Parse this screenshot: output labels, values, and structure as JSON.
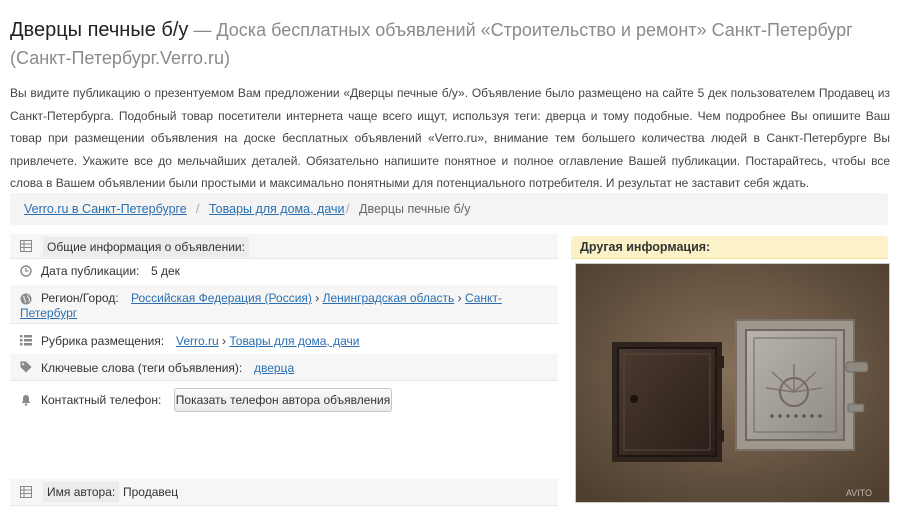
{
  "header": {
    "title": "Дверцы печные б/у",
    "subtitle": " — Доска бесплатных объявлений «Строительство и ремонт» Санкт-Петербург (Санкт-Петербург.Verro.ru)"
  },
  "intro": "Вы видите публикацию о презентуемом Вам предложении «Дверцы печные б/у». Объявление было размещено на сайте 5 дек пользователем Продавец из Санкт-Петербурга. Подобный товар посетители интернета чаще всего ищут, используя теги: дверца и тому подобные. Чем подробнее Вы опишите Ваш товар при размещении объявления на доске бесплатных объявлений «Verro.ru», внимание тем большего количества людей в Санкт-Петербурге Вы привлечете. Укажите все до мельчайших деталей. Обязательно напишите понятное и полное оглавление Вашей публикации. Постарайтесь, чтобы все слова в Вашем объявлении были простыми и максимально понятными для потенциального потребителя. И результат не заставит себя ждать.",
  "breadcrumb": {
    "items": [
      "Verro.ru в Санкт-Петербурге",
      "Товары для дома, дачи"
    ],
    "separator": "/",
    "current": "Дверцы печные б/у"
  },
  "info": {
    "header": "Общие информация о объявлении:",
    "date_label": "Дата публикации:",
    "date_value": "5 дек",
    "region_label": "Регион/Город:",
    "region_country": "Российская Федерация (Россия)",
    "region_oblast": "Ленинградская область",
    "region_city_1": "Санкт-",
    "region_city_2": "Петербург",
    "arrow": "›",
    "rubric_label": "Рубрика размещения:",
    "rubric_site": "Verro.ru",
    "rubric_cat": "Товары для дома, дачи",
    "keywords_label": "Ключевые слова (теги объявления):",
    "keyword": "дверца",
    "phone_label": "Контактный телефон:",
    "phone_button": "Показать телефон автора объявления",
    "author_label": "Имя автора:",
    "author_value": "Продавец"
  },
  "other": {
    "header": "Другая информация:",
    "watermark": "AVITO"
  },
  "icons": {
    "info": "table-icon",
    "date": "clock-icon",
    "region": "globe-icon",
    "rubric": "list-icon",
    "keywords": "tag-icon",
    "phone": "bell-icon",
    "author": "table-icon"
  }
}
